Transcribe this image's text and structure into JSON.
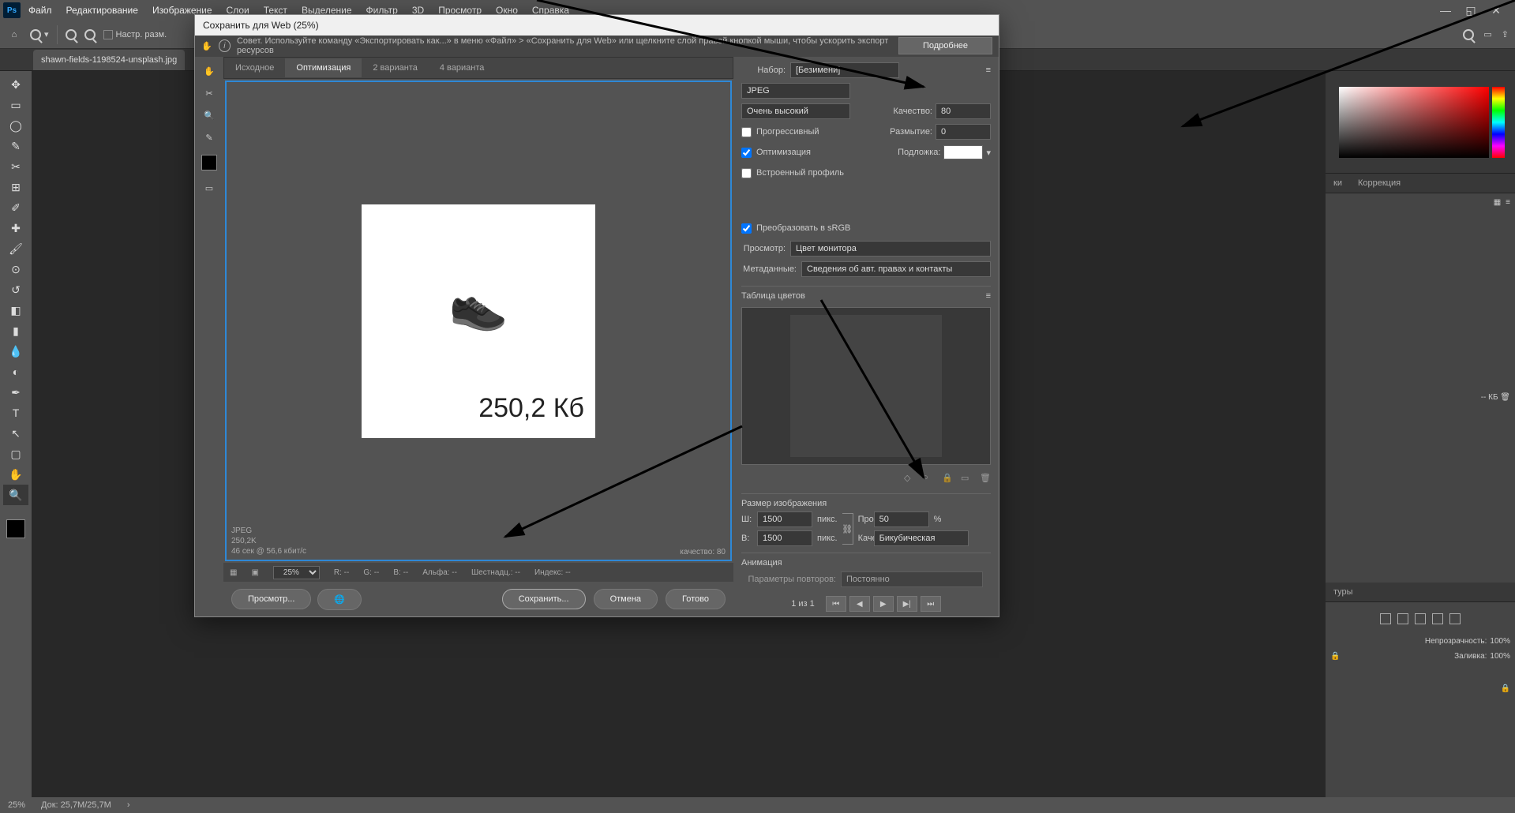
{
  "menubar": [
    "Файл",
    "Редактирование",
    "Изображение",
    "Слои",
    "Текст",
    "Выделение",
    "Фильтр",
    "3D",
    "Просмотр",
    "Окно",
    "Справка"
  ],
  "options": {
    "resize_label": "Настр. разм."
  },
  "doc_tab": "shawn-fields-1198524-unsplash.jpg",
  "right_panels": {
    "tab_swatches": "ки",
    "tab_correction": "Коррекция",
    "tab_contours": "туры",
    "opacity_label": "Непрозрачность:",
    "opacity_value": "100%",
    "fill_label": "Заливка:",
    "fill_value": "100%",
    "kb_label": "-- КБ"
  },
  "statusbar": {
    "zoom": "25%",
    "docinfo": "Док: 25,7M/25,7M"
  },
  "dialog": {
    "title": "Сохранить для Web (25%)",
    "tip": "Совет. Используйте команду «Экспортировать как...» в меню «Файл» > «Сохранить для Web» или щелкните слой правой кнопкой мыши, чтобы ускорить экспорт ресурсов",
    "tip_more": "Подробнее",
    "tabs": [
      "Исходное",
      "Оптимизация",
      "2 варианта",
      "4 варианта"
    ],
    "active_tab": 1,
    "preview": {
      "format": "JPEG",
      "size": "250,2K",
      "time": "46 сек @ 56,6 кбит/с",
      "quality_label": "качество: 80",
      "overlay_size": "250,2 Кб"
    },
    "bottom": {
      "zoom": "25%",
      "r": "R: --",
      "g": "G: --",
      "b": "B: --",
      "alpha": "Альфа: --",
      "hex": "Шестнадц.: --",
      "index": "Индекс: --"
    },
    "buttons": {
      "preview": "Просмотр...",
      "save": "Сохранить...",
      "cancel": "Отмена",
      "done": "Готово"
    },
    "settings": {
      "preset_label": "Набор:",
      "preset_value": "[Безимени]",
      "format": "JPEG",
      "quality_preset": "Очень высокий",
      "quality_label": "Качество:",
      "quality_value": "80",
      "blur_label": "Размытие:",
      "blur_value": "0",
      "matte_label": "Подложка:",
      "progressive": "Прогрессивный",
      "optimized": "Оптимизация",
      "embed_profile": "Встроенный профиль",
      "convert_srgb": "Преобразовать в sRGB",
      "preview_label": "Просмотр:",
      "preview_value": "Цвет монитора",
      "metadata_label": "Метаданные:",
      "metadata_value": "Сведения об авт. правах и контакты",
      "color_table": "Таблица цветов",
      "image_size": "Размер изображения",
      "width_label": "Ш:",
      "width_value": "1500",
      "height_label": "В:",
      "height_value": "1500",
      "px": "пикс.",
      "percent_label": "Проценты:",
      "percent_value": "50",
      "percent_sign": "%",
      "resample_label": "Качество:",
      "resample_value": "Бикубическая",
      "animation": "Анимация",
      "loop_label": "Параметры повторов:",
      "loop_value": "Постоянно",
      "frame_info": "1 из 1"
    }
  }
}
